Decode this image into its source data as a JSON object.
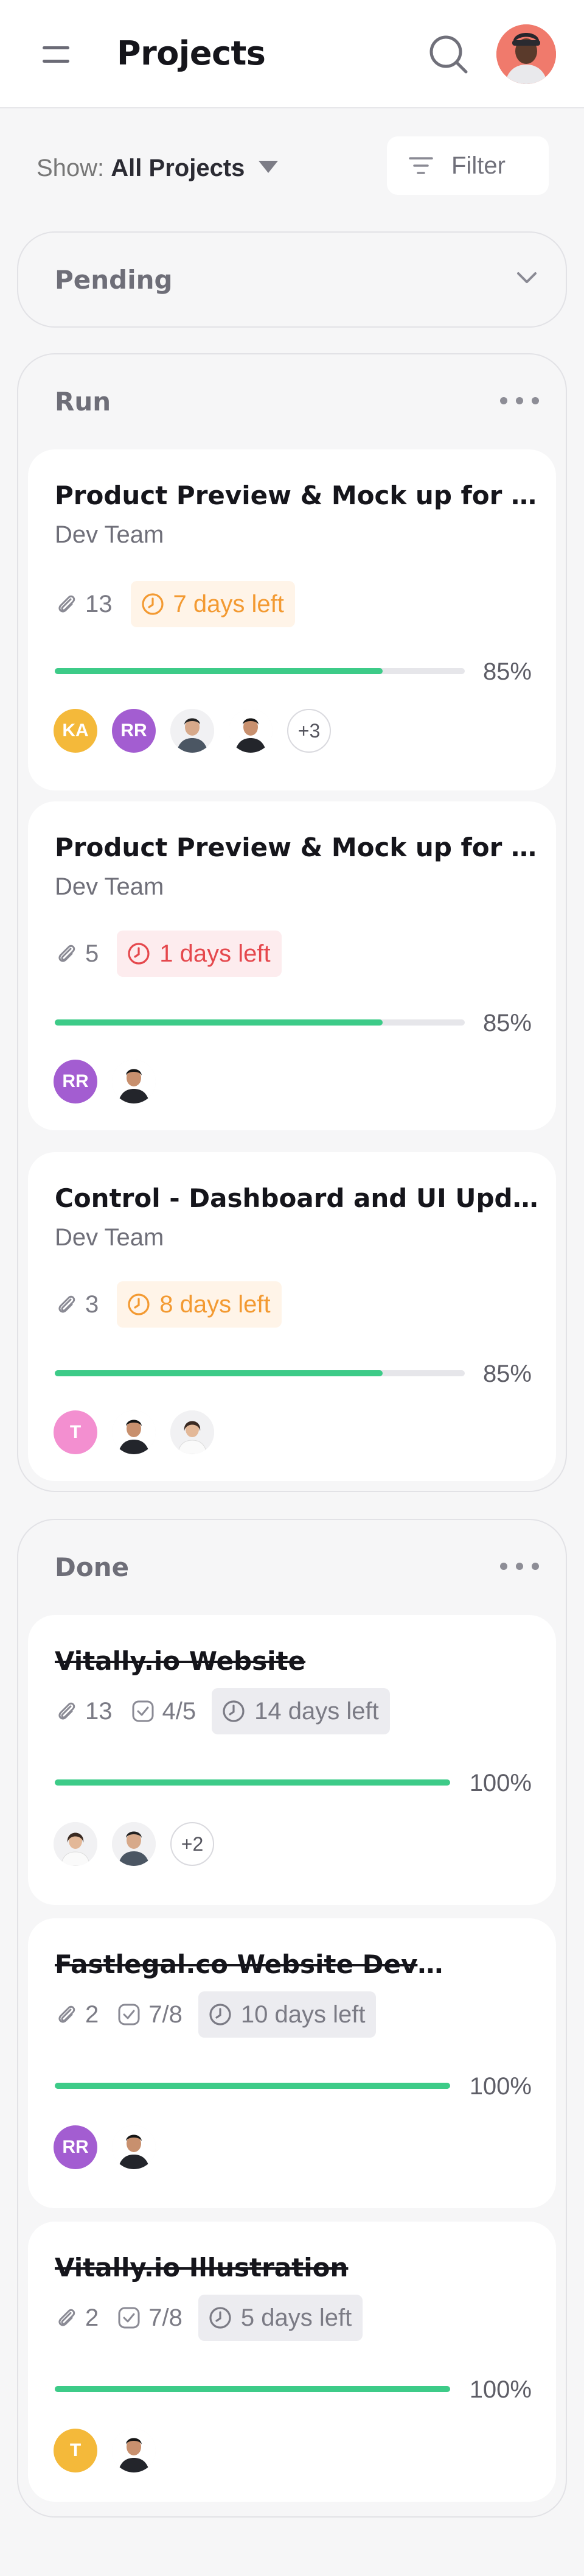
{
  "header": {
    "title": "Projects"
  },
  "toolbar": {
    "show_prefix": "Show:",
    "show_value": "All Projects",
    "filter_label": "Filter"
  },
  "pending": {
    "label": "Pending"
  },
  "groups": {
    "run": {
      "label": "Run",
      "cards": [
        {
          "title": "Product Preview & Mock up for Marketing",
          "team": "Dev Team",
          "attachments": "13",
          "due": "7 days left",
          "progress_label": "85%",
          "progress": 0.85,
          "members": [
            {
              "initials": "KA",
              "color": "#f4b93a"
            },
            {
              "initials": "RR",
              "color": "#a35dd1"
            },
            {
              "photo": "man-light-shirt"
            },
            {
              "photo": "man-dark-shirt"
            }
          ],
          "more": "+3"
        },
        {
          "title": "Product Preview & Mock up for Marketing",
          "team": "Dev Team",
          "attachments": "5",
          "due": "1 days left",
          "progress_label": "85%",
          "progress": 0.85,
          "members": [
            {
              "initials": "RR",
              "color": "#a35dd1"
            },
            {
              "photo": "man-dark-shirt"
            }
          ]
        },
        {
          "title": "Control - Dashboard and UI Updates",
          "team": "Dev Team",
          "attachments": "3",
          "due": "8 days left",
          "progress_label": "85%",
          "progress": 0.85,
          "members": [
            {
              "initials": "T",
              "color": "#f38fd0"
            },
            {
              "photo": "man-dark-shirt"
            },
            {
              "photo": "woman-white-shirt"
            }
          ]
        }
      ]
    },
    "done": {
      "label": "Done",
      "cards": [
        {
          "title": "Vitally.io Website",
          "attachments": "13",
          "tasks": "4/5",
          "due": "14 days left",
          "progress_label": "100%",
          "progress": 1.0,
          "members": [
            {
              "photo": "woman-white-shirt"
            },
            {
              "photo": "man-dark-shirt"
            }
          ],
          "more": "+2"
        },
        {
          "title": "Fastlegal.co Website Development",
          "attachments": "2",
          "tasks": "7/8",
          "due": "10 days left",
          "progress_label": "100%",
          "progress": 1.0,
          "members": [
            {
              "initials": "RR",
              "color": "#a35dd1"
            },
            {
              "photo": "man-dark-shirt"
            }
          ]
        },
        {
          "title": "Vitally.io Illustration",
          "attachments": "2",
          "tasks": "7/8",
          "due": "5 days left",
          "progress_label": "100%",
          "progress": 1.0,
          "members": [
            {
              "initials": "T",
              "color": "#f4b93a"
            },
            {
              "photo": "man-dark-shirt"
            }
          ]
        }
      ]
    }
  },
  "colors": {
    "accent_green": "#3dcb88",
    "due_orange": "#f39a32",
    "due_red": "#e5484d",
    "muted": "#7b7b85"
  }
}
